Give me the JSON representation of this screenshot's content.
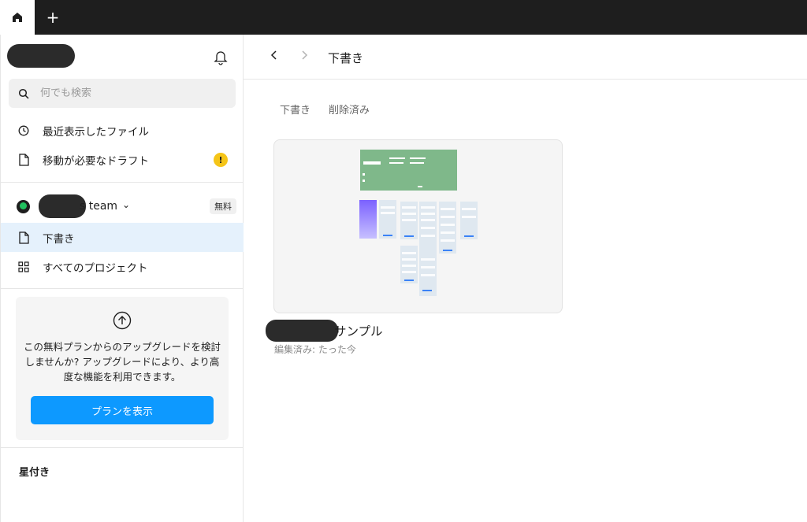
{
  "topbar": {
    "home_tab": "home-icon",
    "add_tab": "+"
  },
  "sidebar": {
    "search": {
      "placeholder": "何でも検索"
    },
    "items": [
      {
        "label": "最近表示したファイル",
        "icon": "clock-icon"
      },
      {
        "label": "移動が必要なドラフト",
        "icon": "file-icon",
        "badge": "!"
      }
    ],
    "team": {
      "name_suffix": "s team",
      "plan_badge": "無料"
    },
    "team_items": [
      {
        "label": "下書き",
        "icon": "file-icon",
        "active": true
      },
      {
        "label": "すべてのプロジェクト",
        "icon": "grid-icon"
      }
    ],
    "upgrade": {
      "text": "この無料プランからのアップグレードを検討しませんか? アップグレードにより、より高度な機能を利用できます。",
      "button": "プランを表示"
    },
    "starred_heading": "星付き"
  },
  "main": {
    "title": "下書き",
    "tabs": [
      "下書き",
      "削除済み"
    ],
    "files": [
      {
        "name_suffix": "サンプル",
        "meta": "編集済み: たった今"
      }
    ]
  },
  "colors": {
    "accent": "#0d99ff",
    "active_bg": "#e5f1fc",
    "warning": "#f5c518",
    "thumb_green": "#7fb88a"
  }
}
